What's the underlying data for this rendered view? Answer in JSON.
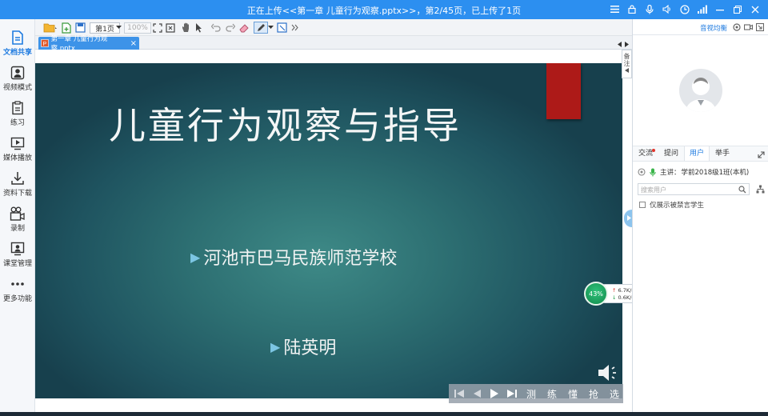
{
  "titlebar": {
    "title": "正在上传<<第一章  儿童行为观察.pptx>>，第2/45页，已上传了1页",
    "icons": [
      "menu-icon",
      "lock-icon",
      "mic-icon",
      "speaker-icon",
      "clock-icon",
      "signal-icon",
      "minimize-icon",
      "restore-icon",
      "close-icon"
    ]
  },
  "sidebar": {
    "items": [
      {
        "label": "文档共享",
        "icon": "document-share-icon",
        "active": true
      },
      {
        "label": "视频模式",
        "icon": "video-mode-icon"
      },
      {
        "label": "练习",
        "icon": "exercise-icon"
      },
      {
        "label": "媒体播放",
        "icon": "media-play-icon"
      },
      {
        "label": "资料下载",
        "icon": "download-icon"
      },
      {
        "label": "录制",
        "icon": "record-icon"
      },
      {
        "label": "课堂管理",
        "icon": "class-manage-icon"
      },
      {
        "label": "更多功能",
        "icon": "more-icon"
      }
    ]
  },
  "toolbar": {
    "page_select": "第1页",
    "zoom": "100%"
  },
  "tab": {
    "label": "第一章  儿童行为观察.pptx",
    "close": "×"
  },
  "slide": {
    "title": "儿童行为观察与指导",
    "bullets": [
      "河池市巴马民族师范学校",
      "陆英明"
    ],
    "bullet_marker": "▶",
    "notes_tab": "备注"
  },
  "playbar": {
    "words": [
      "测",
      "练",
      "懂",
      "抢",
      "选"
    ]
  },
  "network": {
    "percent": "43%",
    "up": "6.7K/s",
    "down": "0.6K/s"
  },
  "right_panel": {
    "header_link": "音视均衡",
    "tabs": [
      "交流",
      "提问",
      "用户",
      "举手"
    ],
    "active_tab": "用户",
    "host_label": "主讲：",
    "host_name": "学前2018级1班(本机)",
    "search_placeholder": "搜索用户",
    "checkbox_label": "仅展示被禁言学生"
  },
  "colors": {
    "accent": "#2c8ff0",
    "slide_bg": "#2d6f72",
    "deco_red": "#ad1a18"
  }
}
